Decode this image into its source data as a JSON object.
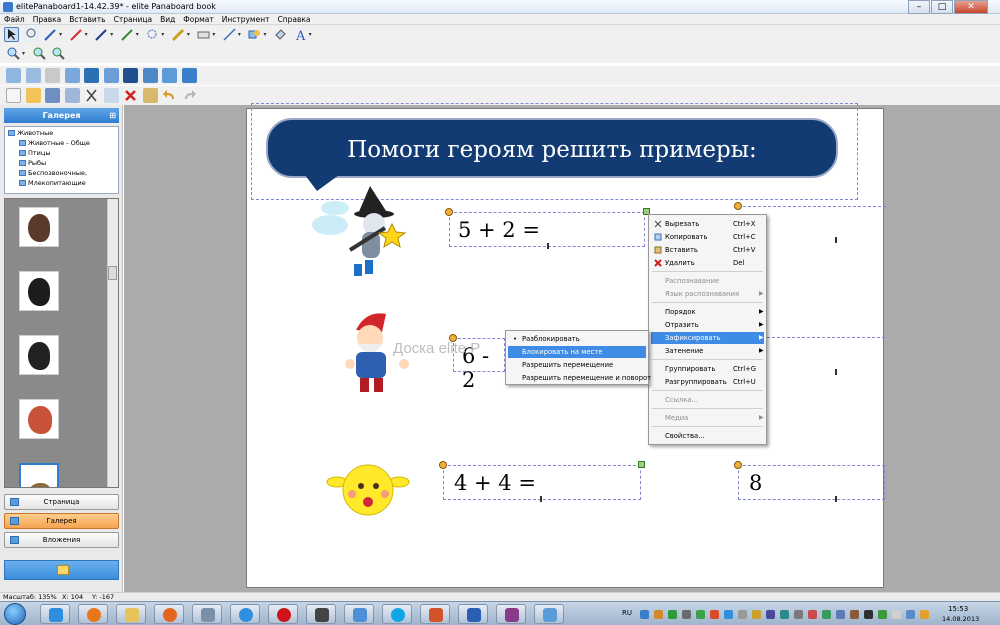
{
  "window": {
    "title": "elitePanaboard1-14.42.39* - elite Panaboard book",
    "btn_minimize": "–",
    "btn_maximize": "□",
    "btn_close": "✕"
  },
  "menu": [
    "Файл",
    "Правка",
    "Вставить",
    "Страница",
    "Вид",
    "Формат",
    "Инструмент",
    "Справка"
  ],
  "sidebar": {
    "gallery_title": "Галерея",
    "pin": "⊞",
    "tree": [
      "Животные",
      "Животные - Обще",
      "Птицы",
      "Рыбы",
      "Беспозвоночные,",
      "Млекопитающие"
    ],
    "buttons": [
      {
        "label": "Страница"
      },
      {
        "label": "Галерея"
      },
      {
        "label": "Вложения"
      }
    ]
  },
  "slide": {
    "banner": "Помоги героям решить примеры:",
    "equations": [
      "5 + 2 =",
      "6 - 2",
      "4 + 4 ="
    ],
    "answer": "8",
    "watermark": "Доска elite P"
  },
  "context_menu": {
    "items": [
      {
        "label": "Вырезать",
        "shortcut": "Ctrl+X",
        "icon": "scissors-icon"
      },
      {
        "label": "Копировать",
        "shortcut": "Ctrl+C",
        "icon": "copy-icon"
      },
      {
        "label": "Вставить",
        "shortcut": "Ctrl+V",
        "icon": "paste-icon"
      },
      {
        "label": "Удалить",
        "shortcut": "Del",
        "icon": "delete-icon"
      },
      {
        "label": "Распознавание"
      },
      {
        "label": "Язык распознавания"
      },
      {
        "label": "Порядок"
      },
      {
        "label": "Отразить"
      },
      {
        "label": "Зафиксировать"
      },
      {
        "label": "Затенение"
      },
      {
        "label": "Группировать",
        "shortcut": "Ctrl+G"
      },
      {
        "label": "Разгруппировать",
        "shortcut": "Ctrl+U"
      },
      {
        "label": "Ссылка..."
      },
      {
        "label": "Медиа"
      },
      {
        "label": "Свойства..."
      }
    ],
    "arrow": "▶"
  },
  "submenu": {
    "items": [
      {
        "label": "Разблокировать",
        "bullet": "•"
      },
      {
        "label": "Блокировать на месте"
      },
      {
        "label": "Разрешить перемещение"
      },
      {
        "label": "Разрешить перемещение и поворот"
      }
    ]
  },
  "status": {
    "scale": "Масштаб: 135%",
    "x": "X: 104",
    "y": "Y: -167"
  },
  "taskbar": {
    "lang": "RU",
    "time": "15:53",
    "date": "14.08.2013"
  },
  "colors": {
    "banner": "#123a73",
    "accent": "#2f7dd1",
    "highlight": "#3f8ce6",
    "active_tab": "#f6a34e"
  }
}
